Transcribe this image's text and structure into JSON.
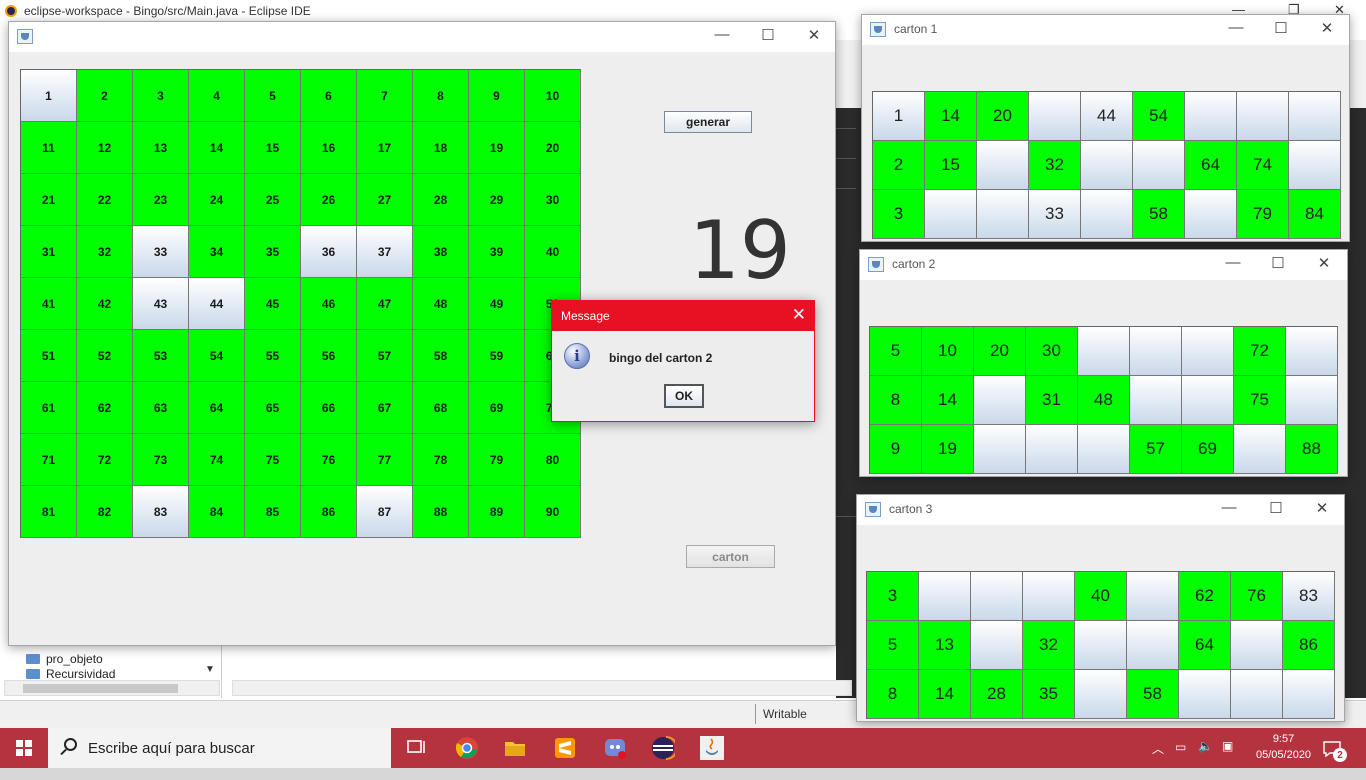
{
  "eclipse": {
    "title": "eclipse-workspace - Bingo/src/Main.java - Eclipse IDE",
    "explorer_items": [
      "pro_objeto",
      "Recursividad"
    ],
    "status": "Writable"
  },
  "main_window": {
    "generate_button": "generar",
    "current_number": "19",
    "carton_button": "carton",
    "board": [
      [
        {
          "n": "1",
          "on": false
        },
        {
          "n": "2",
          "on": true
        },
        {
          "n": "3",
          "on": true
        },
        {
          "n": "4",
          "on": true
        },
        {
          "n": "5",
          "on": true
        },
        {
          "n": "6",
          "on": true
        },
        {
          "n": "7",
          "on": true
        },
        {
          "n": "8",
          "on": true
        },
        {
          "n": "9",
          "on": true
        },
        {
          "n": "10",
          "on": true
        }
      ],
      [
        {
          "n": "11",
          "on": true
        },
        {
          "n": "12",
          "on": true
        },
        {
          "n": "13",
          "on": true
        },
        {
          "n": "14",
          "on": true
        },
        {
          "n": "15",
          "on": true
        },
        {
          "n": "16",
          "on": true
        },
        {
          "n": "17",
          "on": true
        },
        {
          "n": "18",
          "on": true
        },
        {
          "n": "19",
          "on": true
        },
        {
          "n": "20",
          "on": true
        }
      ],
      [
        {
          "n": "21",
          "on": true
        },
        {
          "n": "22",
          "on": true
        },
        {
          "n": "23",
          "on": true
        },
        {
          "n": "24",
          "on": true
        },
        {
          "n": "25",
          "on": true
        },
        {
          "n": "26",
          "on": true
        },
        {
          "n": "27",
          "on": true
        },
        {
          "n": "28",
          "on": true
        },
        {
          "n": "29",
          "on": true
        },
        {
          "n": "30",
          "on": true
        }
      ],
      [
        {
          "n": "31",
          "on": true
        },
        {
          "n": "32",
          "on": true
        },
        {
          "n": "33",
          "on": false
        },
        {
          "n": "34",
          "on": true
        },
        {
          "n": "35",
          "on": true
        },
        {
          "n": "36",
          "on": false
        },
        {
          "n": "37",
          "on": false
        },
        {
          "n": "38",
          "on": true
        },
        {
          "n": "39",
          "on": true
        },
        {
          "n": "40",
          "on": true
        }
      ],
      [
        {
          "n": "41",
          "on": true
        },
        {
          "n": "42",
          "on": true
        },
        {
          "n": "43",
          "on": false
        },
        {
          "n": "44",
          "on": false
        },
        {
          "n": "45",
          "on": true
        },
        {
          "n": "46",
          "on": true
        },
        {
          "n": "47",
          "on": true
        },
        {
          "n": "48",
          "on": true
        },
        {
          "n": "49",
          "on": true
        },
        {
          "n": "50",
          "on": true
        }
      ],
      [
        {
          "n": "51",
          "on": true
        },
        {
          "n": "52",
          "on": true
        },
        {
          "n": "53",
          "on": true
        },
        {
          "n": "54",
          "on": true
        },
        {
          "n": "55",
          "on": true
        },
        {
          "n": "56",
          "on": true
        },
        {
          "n": "57",
          "on": true
        },
        {
          "n": "58",
          "on": true
        },
        {
          "n": "59",
          "on": true
        },
        {
          "n": "60",
          "on": true
        }
      ],
      [
        {
          "n": "61",
          "on": true
        },
        {
          "n": "62",
          "on": true
        },
        {
          "n": "63",
          "on": true
        },
        {
          "n": "64",
          "on": true
        },
        {
          "n": "65",
          "on": true
        },
        {
          "n": "66",
          "on": true
        },
        {
          "n": "67",
          "on": true
        },
        {
          "n": "68",
          "on": true
        },
        {
          "n": "69",
          "on": true
        },
        {
          "n": "70",
          "on": true
        }
      ],
      [
        {
          "n": "71",
          "on": true
        },
        {
          "n": "72",
          "on": true
        },
        {
          "n": "73",
          "on": true
        },
        {
          "n": "74",
          "on": true
        },
        {
          "n": "75",
          "on": true
        },
        {
          "n": "76",
          "on": true
        },
        {
          "n": "77",
          "on": true
        },
        {
          "n": "78",
          "on": true
        },
        {
          "n": "79",
          "on": true
        },
        {
          "n": "80",
          "on": true
        }
      ],
      [
        {
          "n": "81",
          "on": true
        },
        {
          "n": "82",
          "on": true
        },
        {
          "n": "83",
          "on": false
        },
        {
          "n": "84",
          "on": true
        },
        {
          "n": "85",
          "on": true
        },
        {
          "n": "86",
          "on": true
        },
        {
          "n": "87",
          "on": false
        },
        {
          "n": "88",
          "on": true
        },
        {
          "n": "89",
          "on": true
        },
        {
          "n": "90",
          "on": true
        }
      ]
    ]
  },
  "cartons": [
    {
      "title": "carton 1",
      "rows": [
        [
          {
            "n": "1",
            "on": false
          },
          {
            "n": "14",
            "on": true
          },
          {
            "n": "20",
            "on": true
          },
          {
            "n": "",
            "on": false
          },
          {
            "n": "44",
            "on": false
          },
          {
            "n": "54",
            "on": true
          },
          {
            "n": "",
            "on": false
          },
          {
            "n": "",
            "on": false
          },
          {
            "n": "",
            "on": false
          }
        ],
        [
          {
            "n": "2",
            "on": true
          },
          {
            "n": "15",
            "on": true
          },
          {
            "n": "",
            "on": false
          },
          {
            "n": "32",
            "on": true
          },
          {
            "n": "",
            "on": false
          },
          {
            "n": "",
            "on": false
          },
          {
            "n": "64",
            "on": true
          },
          {
            "n": "74",
            "on": true
          },
          {
            "n": "",
            "on": false
          }
        ],
        [
          {
            "n": "3",
            "on": true
          },
          {
            "n": "",
            "on": false
          },
          {
            "n": "",
            "on": false
          },
          {
            "n": "33",
            "on": false
          },
          {
            "n": "",
            "on": false
          },
          {
            "n": "58",
            "on": true
          },
          {
            "n": "",
            "on": false
          },
          {
            "n": "79",
            "on": true
          },
          {
            "n": "84",
            "on": true
          }
        ]
      ]
    },
    {
      "title": "carton 2",
      "rows": [
        [
          {
            "n": "5",
            "on": true
          },
          {
            "n": "10",
            "on": true
          },
          {
            "n": "20",
            "on": true
          },
          {
            "n": "30",
            "on": true
          },
          {
            "n": "",
            "on": false
          },
          {
            "n": "",
            "on": false
          },
          {
            "n": "",
            "on": false
          },
          {
            "n": "72",
            "on": true
          },
          {
            "n": "",
            "on": false
          }
        ],
        [
          {
            "n": "8",
            "on": true
          },
          {
            "n": "14",
            "on": true
          },
          {
            "n": "",
            "on": false
          },
          {
            "n": "31",
            "on": true
          },
          {
            "n": "48",
            "on": true
          },
          {
            "n": "",
            "on": false
          },
          {
            "n": "",
            "on": false
          },
          {
            "n": "75",
            "on": true
          },
          {
            "n": "",
            "on": false
          }
        ],
        [
          {
            "n": "9",
            "on": true
          },
          {
            "n": "19",
            "on": true
          },
          {
            "n": "",
            "on": false
          },
          {
            "n": "",
            "on": false
          },
          {
            "n": "",
            "on": false
          },
          {
            "n": "57",
            "on": true
          },
          {
            "n": "69",
            "on": true
          },
          {
            "n": "",
            "on": false
          },
          {
            "n": "88",
            "on": true
          }
        ]
      ]
    },
    {
      "title": "carton 3",
      "rows": [
        [
          {
            "n": "3",
            "on": true
          },
          {
            "n": "",
            "on": false
          },
          {
            "n": "",
            "on": false
          },
          {
            "n": "",
            "on": false
          },
          {
            "n": "40",
            "on": true
          },
          {
            "n": "",
            "on": false
          },
          {
            "n": "62",
            "on": true
          },
          {
            "n": "76",
            "on": true
          },
          {
            "n": "83",
            "on": false
          }
        ],
        [
          {
            "n": "5",
            "on": true
          },
          {
            "n": "13",
            "on": true
          },
          {
            "n": "",
            "on": false
          },
          {
            "n": "32",
            "on": true
          },
          {
            "n": "",
            "on": false
          },
          {
            "n": "",
            "on": false
          },
          {
            "n": "64",
            "on": true
          },
          {
            "n": "",
            "on": false
          },
          {
            "n": "86",
            "on": true
          }
        ],
        [
          {
            "n": "8",
            "on": true
          },
          {
            "n": "14",
            "on": true
          },
          {
            "n": "28",
            "on": true
          },
          {
            "n": "35",
            "on": true
          },
          {
            "n": "",
            "on": false
          },
          {
            "n": "58",
            "on": true
          },
          {
            "n": "",
            "on": false
          },
          {
            "n": "",
            "on": false
          },
          {
            "n": "",
            "on": false
          }
        ]
      ]
    }
  ],
  "dialog": {
    "title": "Message",
    "message": "bingo del carton 2",
    "ok": "OK",
    "icon": "info-icon"
  },
  "taskbar": {
    "search_placeholder": "Escribe aquí para buscar",
    "time": "9:57",
    "date": "05/05/2020",
    "notifications": "2"
  },
  "colors": {
    "marked": "#00ff00",
    "dialog_accent": "#e81123",
    "taskbar": "#b5323f"
  }
}
